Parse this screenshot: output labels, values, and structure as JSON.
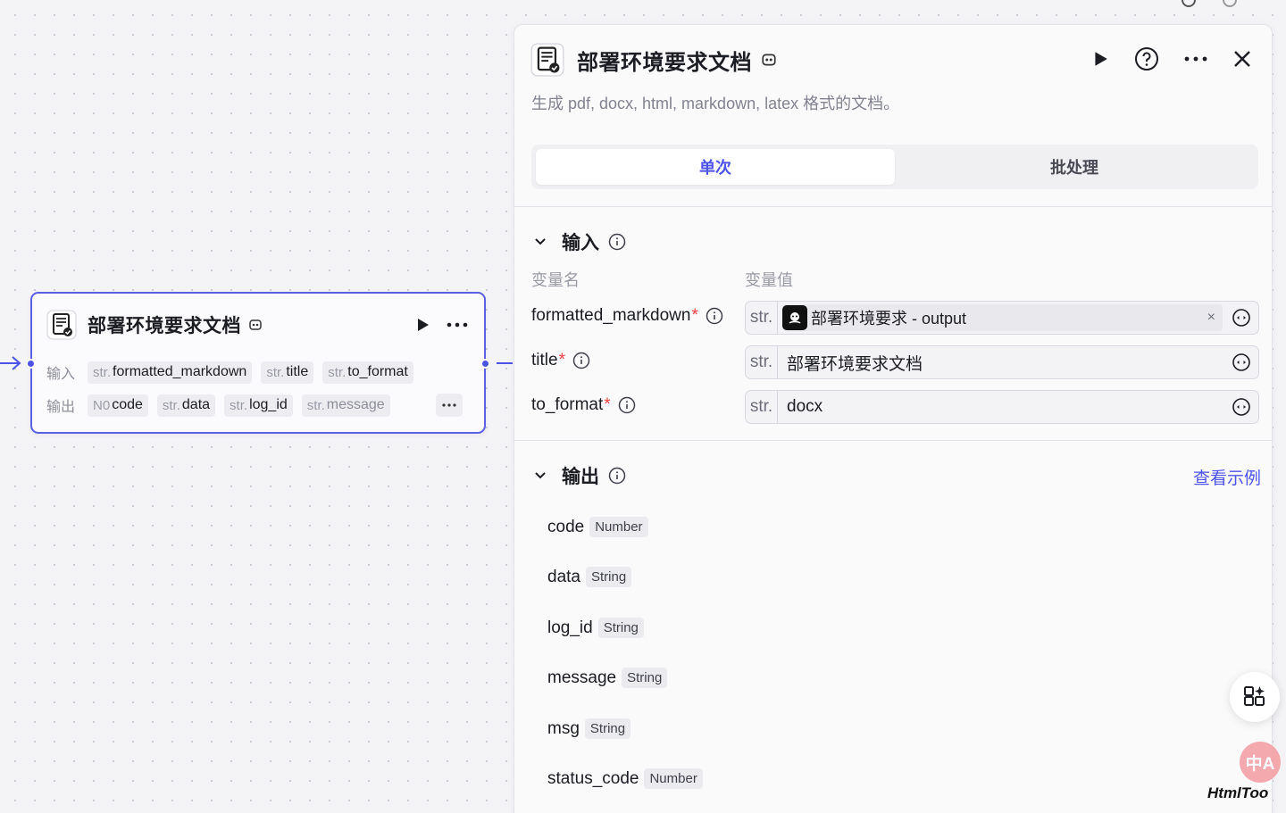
{
  "node": {
    "title": "部署环境要求文档",
    "input_label": "输入",
    "output_label": "输出",
    "inputs": [
      {
        "type": "str.",
        "name": "formatted_markdown"
      },
      {
        "type": "str.",
        "name": "title"
      },
      {
        "type": "str.",
        "name": "to_format"
      }
    ],
    "outputs": [
      {
        "type": "N0",
        "name": "code"
      },
      {
        "type": "str.",
        "name": "data"
      },
      {
        "type": "str.",
        "name": "log_id"
      },
      {
        "type": "str.",
        "name": "message"
      }
    ],
    "more": "···"
  },
  "panel": {
    "title": "部署环境要求文档",
    "description": "生成 pdf, docx, html, markdown, latex 格式的文档。",
    "tabs": [
      {
        "label": "单次",
        "active": true
      },
      {
        "label": "批处理",
        "active": false
      }
    ],
    "input_section": {
      "title": "输入",
      "col_name": "变量名",
      "col_value": "变量值",
      "params": [
        {
          "name": "formatted_markdown",
          "required": "*",
          "type": "str.",
          "ref": "部署环境要求 - output",
          "clear": "×"
        },
        {
          "name": "title",
          "required": "*",
          "type": "str.",
          "value": "部署环境要求文档"
        },
        {
          "name": "to_format",
          "required": "*",
          "type": "str.",
          "value": "docx"
        }
      ]
    },
    "output_section": {
      "title": "输出",
      "view_example": "查看示例",
      "items": [
        {
          "name": "code",
          "type": "Number"
        },
        {
          "name": "data",
          "type": "String"
        },
        {
          "name": "log_id",
          "type": "String"
        },
        {
          "name": "message",
          "type": "String"
        },
        {
          "name": "msg",
          "type": "String"
        },
        {
          "name": "status_code",
          "type": "Number"
        }
      ]
    }
  },
  "translate_label": "中A",
  "watermark": "HtmlToo",
  "colors": {
    "accent": "#4d53e8",
    "required": "#f0403c"
  }
}
